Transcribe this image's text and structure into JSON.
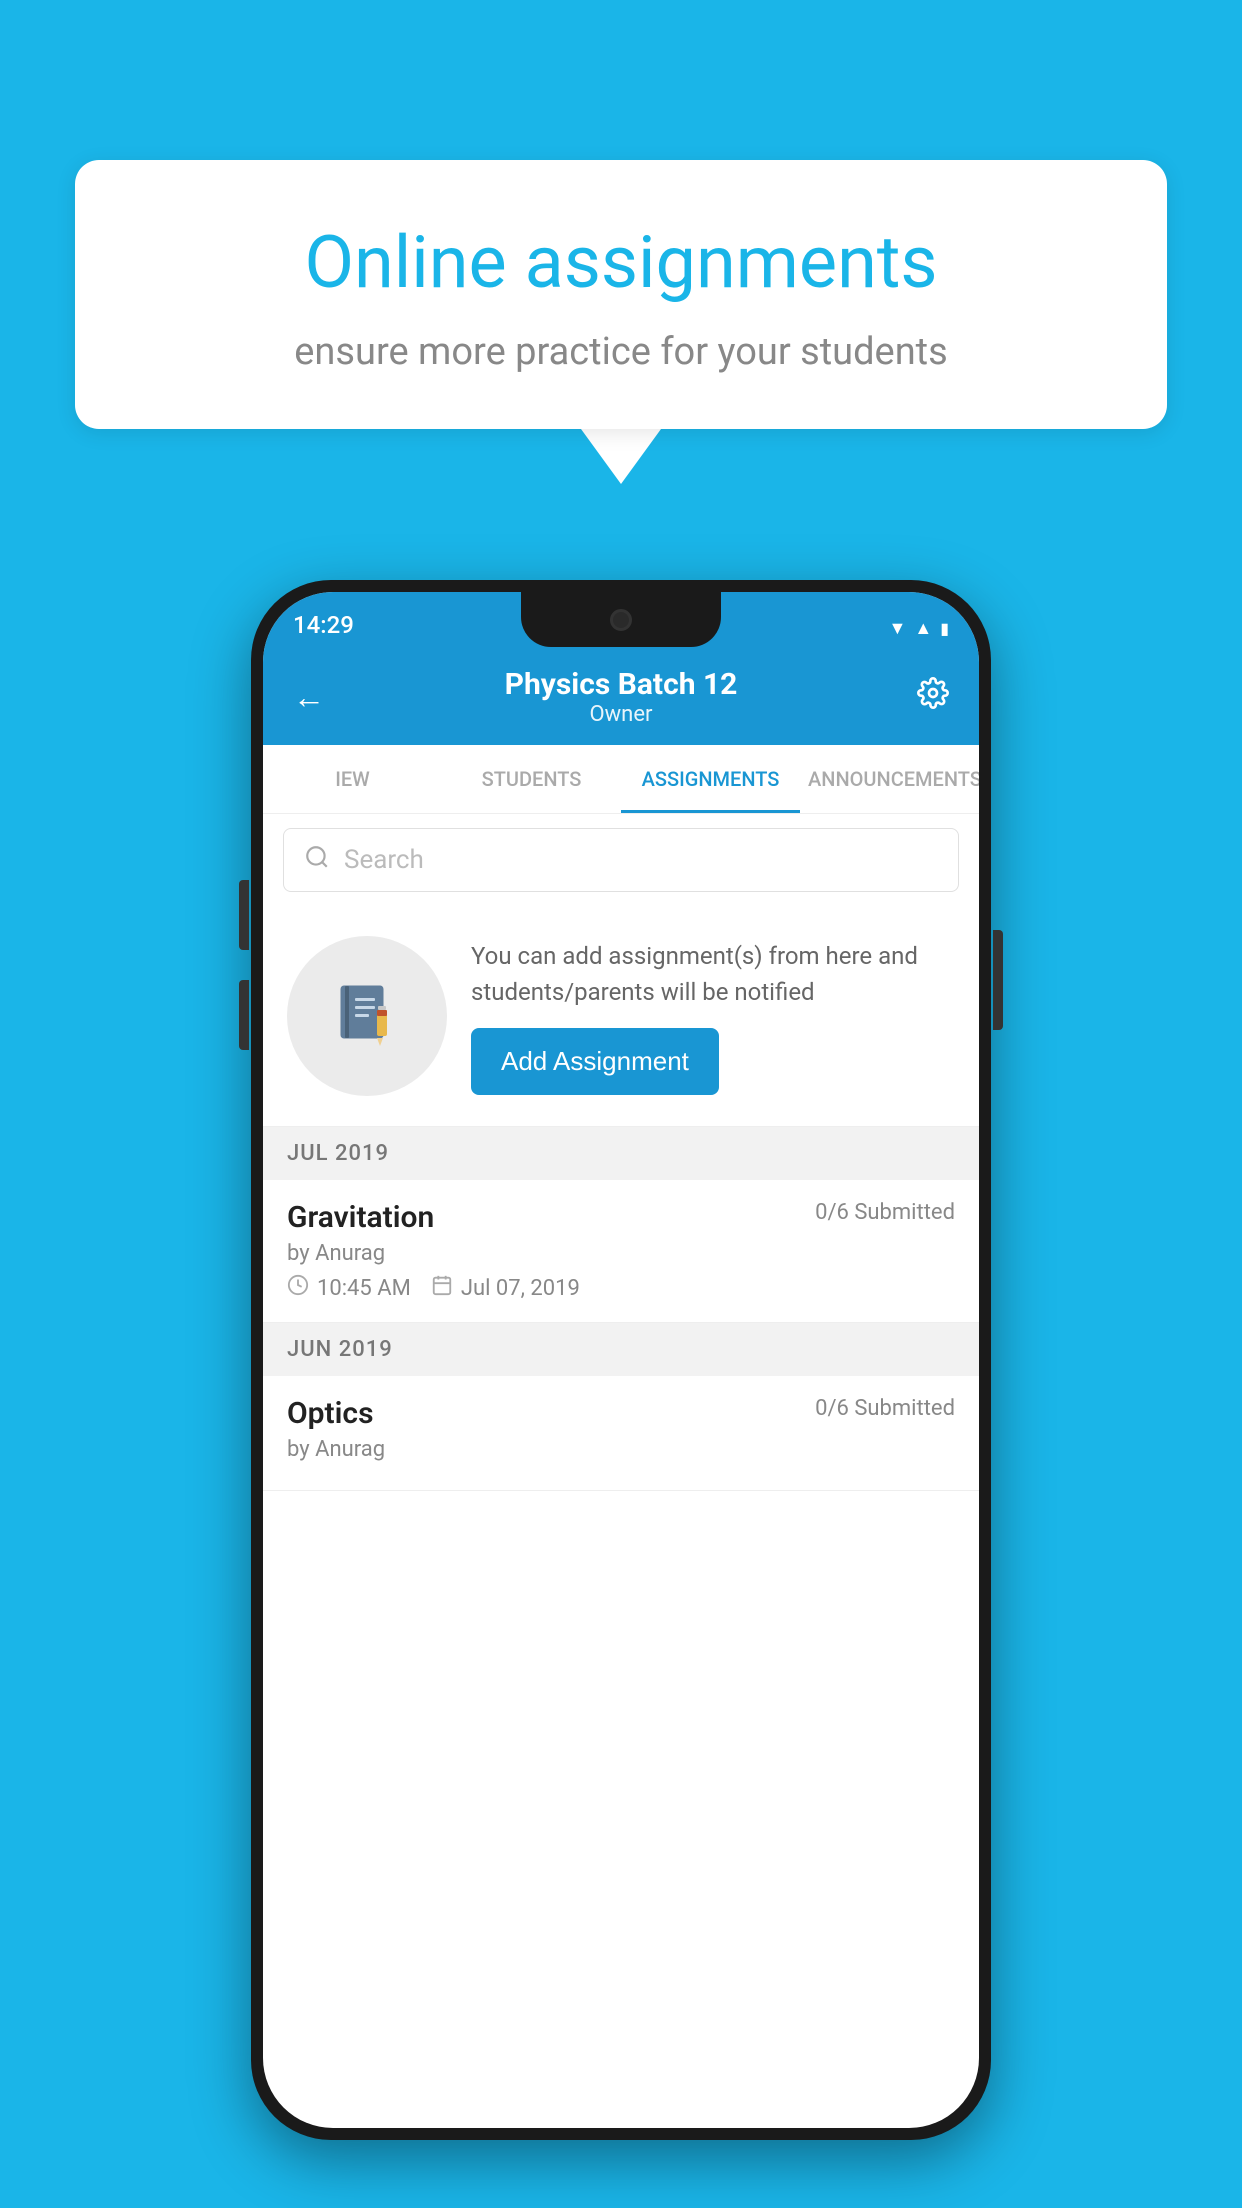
{
  "background_color": "#1ab5e8",
  "speech_bubble": {
    "title": "Online assignments",
    "subtitle": "ensure more practice for your students"
  },
  "status_bar": {
    "time": "14:29",
    "icons": [
      "wifi",
      "signal",
      "battery"
    ]
  },
  "header": {
    "title": "Physics Batch 12",
    "subtitle": "Owner",
    "back_label": "←",
    "settings_label": "⚙"
  },
  "tabs": [
    {
      "label": "IEW",
      "active": false
    },
    {
      "label": "STUDENTS",
      "active": false
    },
    {
      "label": "ASSIGNMENTS",
      "active": true
    },
    {
      "label": "ANNOUNCEMENTS",
      "active": false
    }
  ],
  "search": {
    "placeholder": "Search"
  },
  "promo": {
    "text": "You can add assignment(s) from here and students/parents will be notified",
    "button_label": "Add Assignment"
  },
  "sections": [
    {
      "label": "JUL 2019",
      "assignments": [
        {
          "name": "Gravitation",
          "submitted": "0/6 Submitted",
          "by": "by Anurag",
          "time": "10:45 AM",
          "date": "Jul 07, 2019"
        }
      ]
    },
    {
      "label": "JUN 2019",
      "assignments": [
        {
          "name": "Optics",
          "submitted": "0/6 Submitted",
          "by": "by Anurag",
          "time": "",
          "date": ""
        }
      ]
    }
  ]
}
